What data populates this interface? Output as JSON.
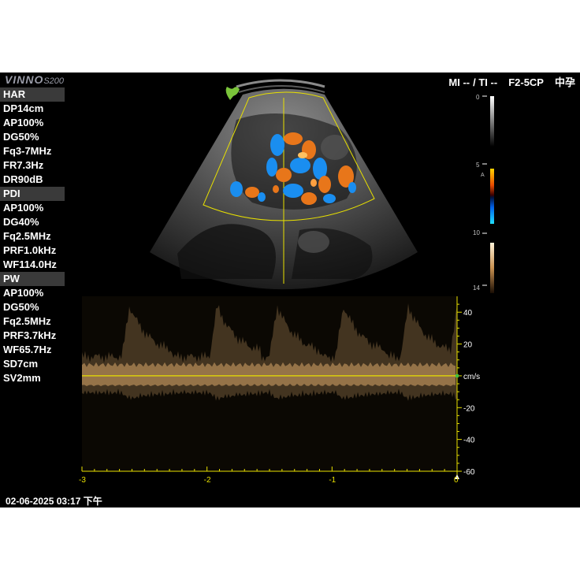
{
  "brand": {
    "name": "VINNO",
    "model": "S200"
  },
  "status": {
    "mi": "MI --",
    "ti": "/ TI --",
    "probe": "F2-5CP",
    "preset": "中孕"
  },
  "params": [
    {
      "label": "HAR",
      "section": true
    },
    {
      "label": "DP14cm"
    },
    {
      "label": "AP100%"
    },
    {
      "label": "DG50%"
    },
    {
      "label": "Fq3-7MHz"
    },
    {
      "label": "FR7.3Hz"
    },
    {
      "label": "DR90dB"
    },
    {
      "label": "PDI",
      "section": true
    },
    {
      "label": "AP100%"
    },
    {
      "label": "DG40%"
    },
    {
      "label": "Fq2.5MHz"
    },
    {
      "label": "PRF1.0kHz"
    },
    {
      "label": "WF114.0Hz"
    },
    {
      "label": "PW",
      "section": true
    },
    {
      "label": "AP100%"
    },
    {
      "label": "DG50%"
    },
    {
      "label": "Fq2.5MHz"
    },
    {
      "label": "PRF3.7kHz"
    },
    {
      "label": "WF65.7Hz"
    },
    {
      "label": "SD7cm"
    },
    {
      "label": "SV2mm"
    }
  ],
  "colorbars": {
    "gray_top": "0",
    "color_top": "5",
    "color_mark": "A",
    "tone_top": "10",
    "tone_bottom": "14"
  },
  "spectrum": {
    "velocity_ticks": [
      "40",
      "20",
      "0",
      "-20",
      "-40",
      "-60"
    ],
    "velocity_values": [
      40,
      20,
      0,
      -20,
      -40,
      -60
    ],
    "velocity_range": [
      -60,
      50
    ],
    "unit": "cm/s",
    "time_ticks": [
      "-3",
      "-2",
      "-1",
      "0"
    ],
    "time_values": [
      -3,
      -2,
      -1,
      0
    ],
    "time_range": [
      -3,
      0
    ]
  },
  "datetime": "02-06-2025 03:17 下午",
  "colors": {
    "yellow": "#e8e000",
    "spectrum": "#d8a86a",
    "doppler_red": "#e8761a",
    "doppler_blue": "#1a8ef0"
  }
}
